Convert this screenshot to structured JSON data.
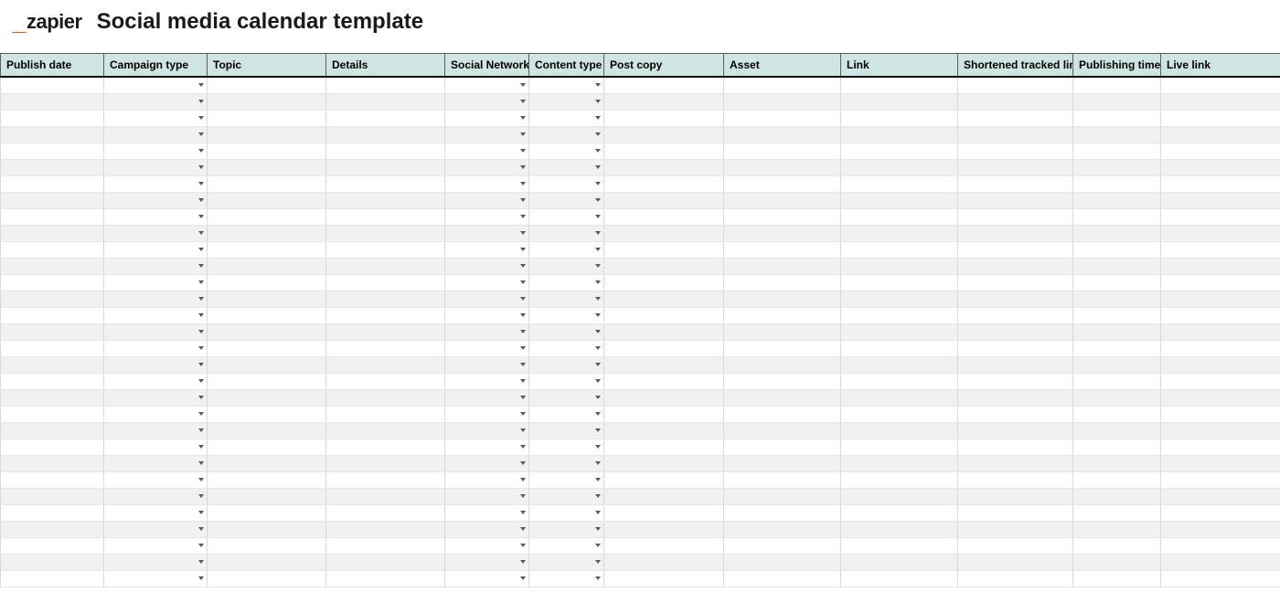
{
  "brand": {
    "name": "zapier",
    "accent_color": "#ff4f00"
  },
  "page": {
    "title": "Social media calendar template"
  },
  "table": {
    "columns": [
      {
        "label": "Publish date",
        "has_dropdown": false
      },
      {
        "label": "Campaign type",
        "has_dropdown": true
      },
      {
        "label": "Topic",
        "has_dropdown": false
      },
      {
        "label": "Details",
        "has_dropdown": false
      },
      {
        "label": "Social Network",
        "has_dropdown": true
      },
      {
        "label": "Content type",
        "has_dropdown": true
      },
      {
        "label": "Post copy",
        "has_dropdown": false
      },
      {
        "label": "Asset",
        "has_dropdown": false
      },
      {
        "label": "Link",
        "has_dropdown": false
      },
      {
        "label": "Shortened tracked link",
        "has_dropdown": false
      },
      {
        "label": "Publishing time",
        "has_dropdown": false
      },
      {
        "label": "Live link",
        "has_dropdown": false
      }
    ],
    "header_bg": "#cfe5e2",
    "row_count": 31
  }
}
